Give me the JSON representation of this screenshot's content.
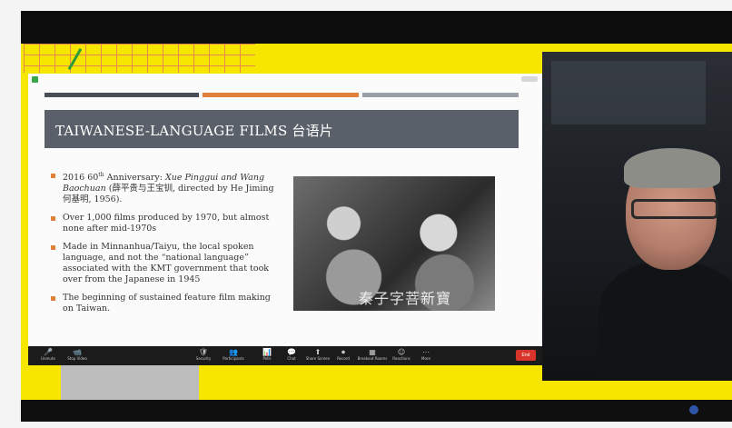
{
  "slide": {
    "title": "TAIWANESE-LANGUAGE FILMS 台语片",
    "bullets": {
      "b1": {
        "pre": "2016 60",
        "sup": "th",
        "mid": " Anniversary: ",
        "italic": "Xue Pinggui and Wang Baochuan",
        "post": " (薛平贵与王宝钏, directed by He Jiming 何基明, 1956)."
      },
      "b2": "Over 1,000 films produced by 1970, but almost none after mid-1970s",
      "b3": "Made in Minnanhua/Taiyu, the local spoken language, and not the “national language” associated with the KMT government that took over from the Japanese in 1945",
      "b4": "The beginning of sustained feature film making on Taiwan."
    },
    "photo_caption": "秦子字菩新寶"
  },
  "toolbar": {
    "items": [
      {
        "icon": "🎤",
        "label": "Unmute"
      },
      {
        "icon": "📹",
        "label": "Stop Video"
      },
      {
        "icon": "🛡",
        "label": "Security"
      },
      {
        "icon": "👥",
        "label": "Participants"
      },
      {
        "icon": "📊",
        "label": "Polls"
      },
      {
        "icon": "💬",
        "label": "Chat"
      },
      {
        "icon": "⬆",
        "label": "Share Screen"
      },
      {
        "icon": "⏺",
        "label": "Record"
      },
      {
        "icon": "▦",
        "label": "Breakout Rooms"
      },
      {
        "icon": "☺",
        "label": "Reactions"
      },
      {
        "icon": "⋯",
        "label": "More"
      }
    ],
    "end_label": "End"
  },
  "colors": {
    "accent_yellow": "#f7e600",
    "slide_bullet": "#e0803a",
    "end_button": "#d9342b"
  }
}
